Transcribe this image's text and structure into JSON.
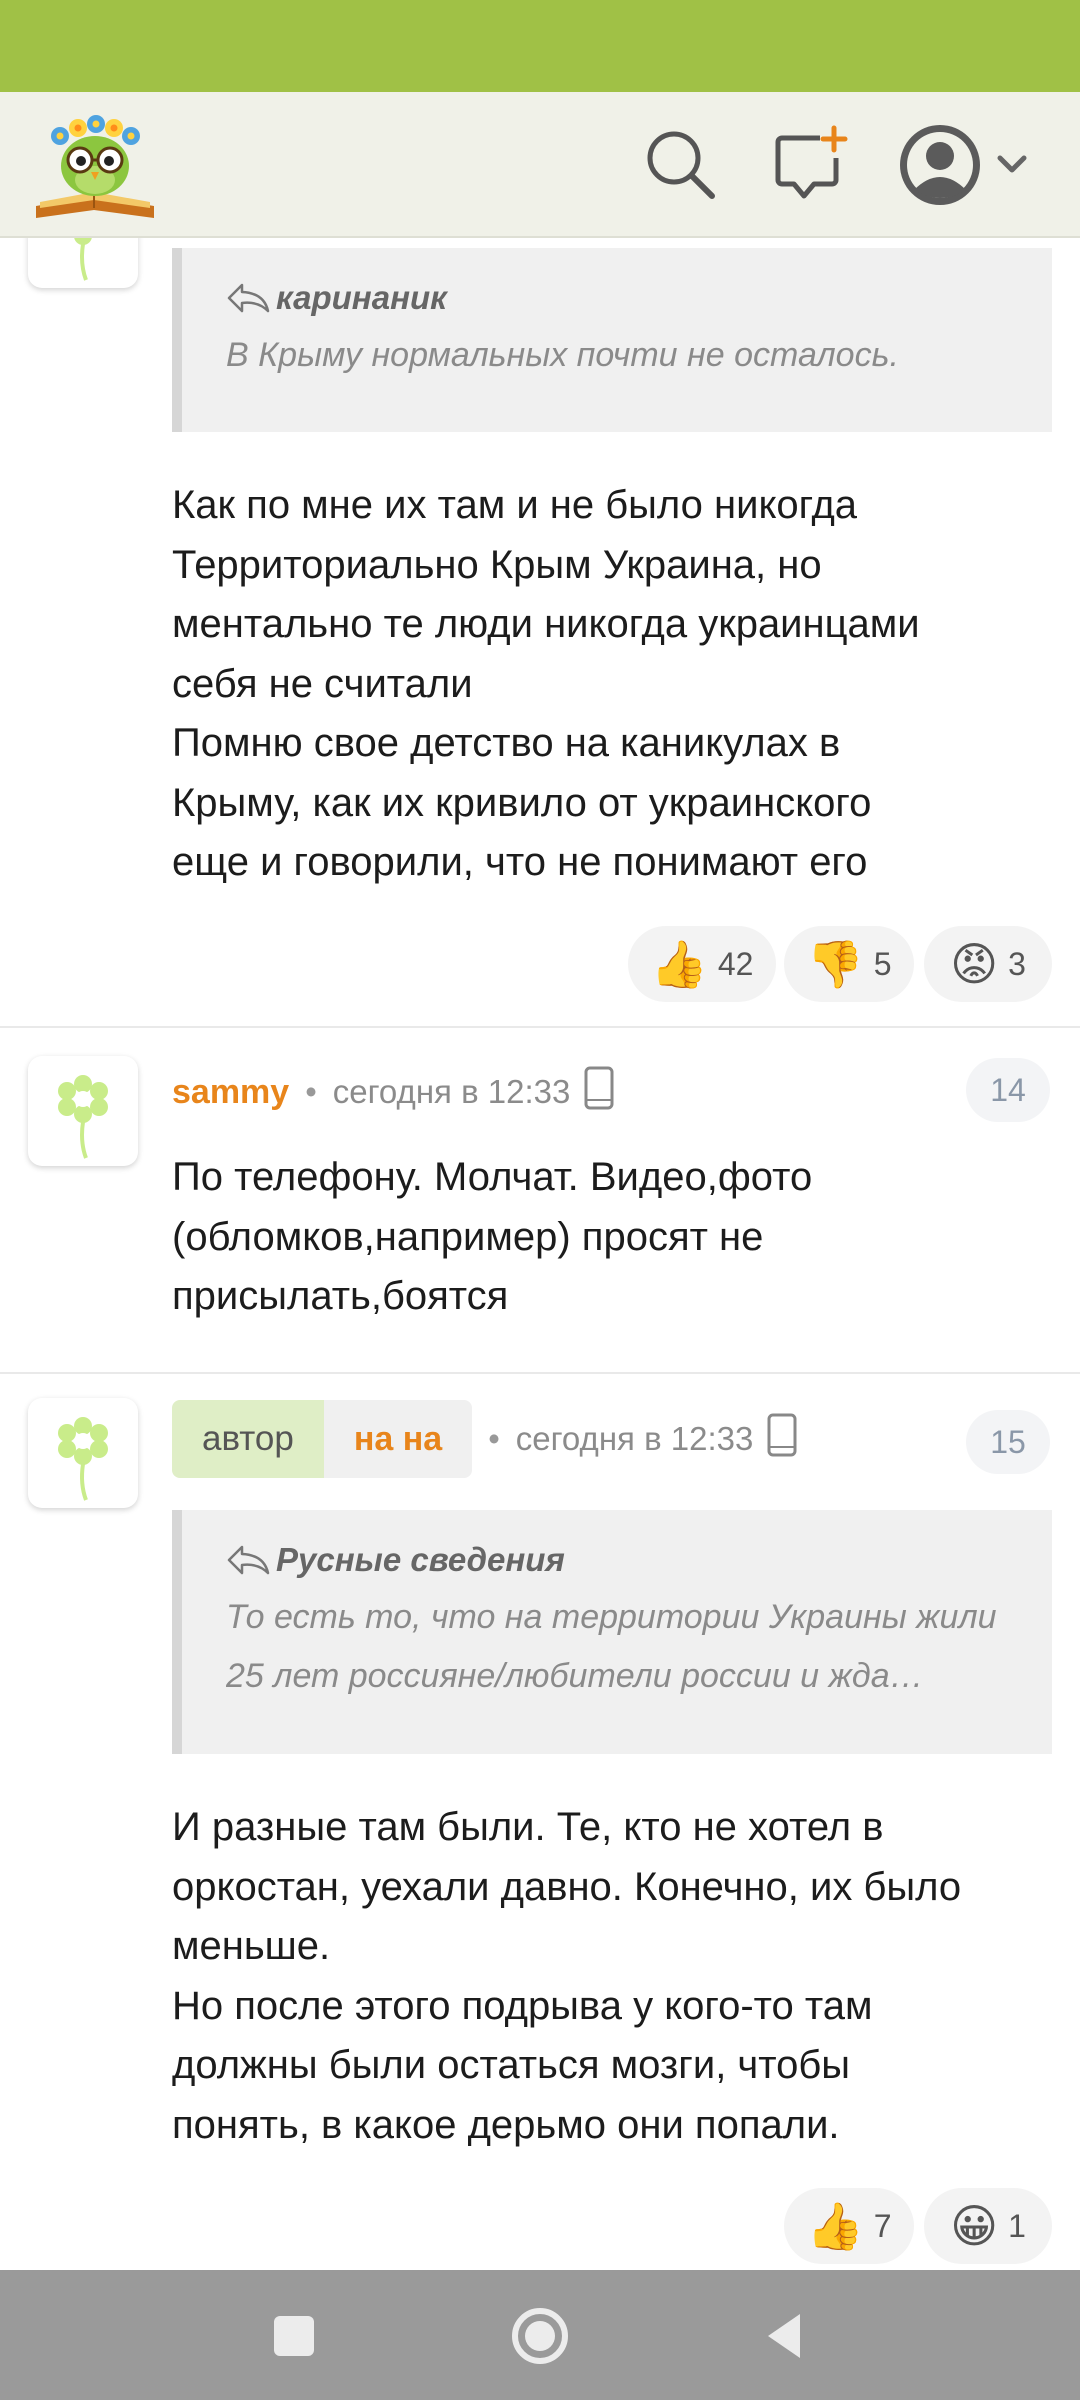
{
  "colors": {
    "status_bar": "#a0c146",
    "header_bg": "#f0f1e8",
    "username": "#e8851b",
    "author_label_bg": "#dfeec6",
    "nav_bar": "#9a9a9a"
  },
  "header": {
    "logo_icon": "owl-book-logo",
    "search_icon": "search-icon",
    "new_post_icon": "new-post-icon",
    "profile_icon": "user-avatar-icon",
    "dropdown_icon": "chevron-down-icon"
  },
  "comments": [
    {
      "quote": {
        "author": "каринаник",
        "text": "В Крыму нормальных почти не осталось."
      },
      "text_lines": [
        "Как по мне их там и не было никогда",
        "Территориально Крым Украина, но",
        "ментально те люди никогда украинцами",
        "себя не считали",
        "Помню свое детство на каникулах в",
        "Крыму, как их кривило от украинского",
        "еще и говорили, что не понимают его"
      ],
      "reactions": [
        {
          "emoji": "👍",
          "count": "42"
        },
        {
          "emoji": "👎",
          "count": "5"
        },
        {
          "emoji": "😡",
          "count": "3"
        }
      ]
    },
    {
      "username": "sammy",
      "time": "сегодня в 12:33",
      "number": "14",
      "text_lines": [
        "По телефону. Молчат. Видео,фото",
        "(обломков,например) просят не",
        "присылать,боятся"
      ]
    },
    {
      "author_label": "автор",
      "username": "на на",
      "time": "сегодня в 12:33",
      "number": "15",
      "quote": {
        "author": "Русные сведения",
        "lines": [
          "То есть то, что на территории Украины жили",
          "25 лет россияне/любители россии и жда…"
        ]
      },
      "text_lines": [
        "И разные там были. Те, кто не хотел в",
        "оркостан, уехали давно. Конечно, их было",
        "меньше.",
        "Но после этого подрыва у кого-то там",
        "должны были остаться мозги, чтобы",
        "понять, в какое дерьмо они попали."
      ],
      "reactions": [
        {
          "emoji": "👍",
          "count": "7"
        },
        {
          "emoji": "😀",
          "count": "1"
        }
      ]
    }
  ],
  "nav": {
    "recents": "square-icon",
    "home": "circle-icon",
    "back": "triangle-back-icon"
  }
}
